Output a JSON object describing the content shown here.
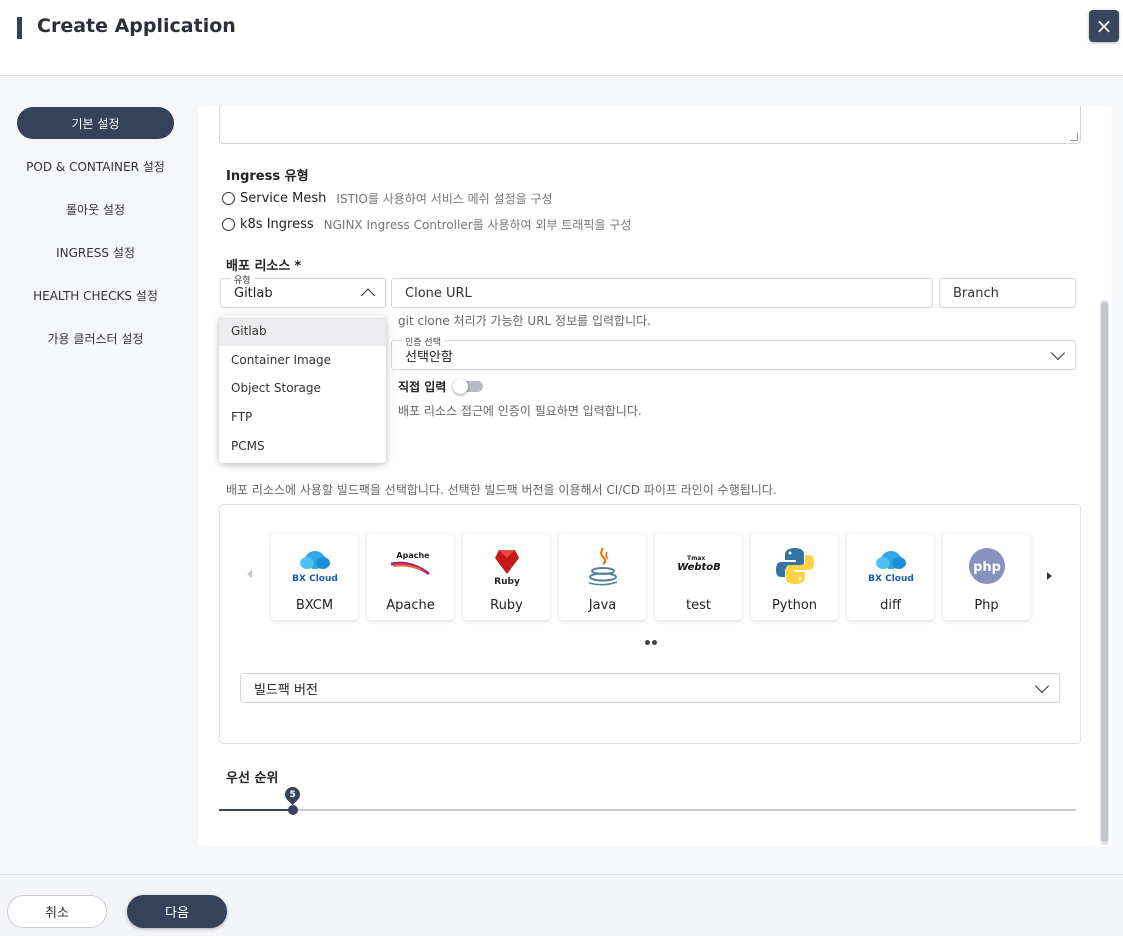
{
  "header": {
    "title": "Create Application",
    "close_icon": "×"
  },
  "sidebar": {
    "items": [
      {
        "label": "기본 설정",
        "active": true
      },
      {
        "label": "POD & CONTAINER 설정"
      },
      {
        "label": "롤아웃 설정"
      },
      {
        "label": "INGRESS 설정"
      },
      {
        "label": "HEALTH CHECKS 설정"
      },
      {
        "label": "가용 클러스터 설정"
      }
    ]
  },
  "ingress": {
    "label": "Ingress 유형",
    "options": [
      {
        "label": "Service Mesh",
        "desc": "ISTIO를 사용하여 서비스 메쉬 설정을 구성"
      },
      {
        "label": "k8s Ingress",
        "desc": "NGINX Ingress Controller를 사용하여 외부 트래픽을 구성"
      }
    ]
  },
  "deploy": {
    "label": "배포 리소스",
    "required": "*",
    "type_label": "유형",
    "type_value": "Gitlab",
    "clone_url_placeholder": "Clone URL",
    "branch_placeholder": "Branch",
    "clone_helper": "git clone 처리가 가능한 URL 정보를 입력합니다.",
    "auth_label": "인증 선택",
    "auth_value": "선택안함",
    "direct_input_label": "직접 입력",
    "auth_helper": "배포 리소스 접근에 인증이 필요하면 입력합니다.",
    "dropdown_options": [
      "Gitlab",
      "Container Image",
      "Object Storage",
      "FTP",
      "PCMS"
    ]
  },
  "buildpack": {
    "helper": "배포 리소스에 사용할 빌드팩을 선택합니다. 선택한 빌드팩 버전을 이용해서 CI/CD 파이프 라인이 수행됩니다.",
    "cards": [
      {
        "label": "BXCM",
        "logo_text": "BX Cloud",
        "icon": "bxcloud-icon"
      },
      {
        "label": "Apache",
        "logo_text": "Apache",
        "icon": "apache-icon"
      },
      {
        "label": "Ruby",
        "logo_text": "Ruby",
        "icon": "ruby-icon"
      },
      {
        "label": "Java",
        "icon": "java-icon"
      },
      {
        "label": "test",
        "logo_text": "WebtoB",
        "logo_small": "Tmax",
        "icon": "webtob-icon"
      },
      {
        "label": "Python",
        "icon": "python-icon"
      },
      {
        "label": "diff",
        "logo_text": "BX Cloud",
        "icon": "bxcloud-icon"
      },
      {
        "label": "Php",
        "logo_text": "php",
        "icon": "php-icon"
      }
    ],
    "version_placeholder": "빌드팩 버전"
  },
  "priority": {
    "label": "우선 순위",
    "value": "5"
  },
  "footer": {
    "cancel_label": "취소",
    "next_label": "다음"
  },
  "colors": {
    "primary": "#36415a",
    "accent_blue": "#2a8de0"
  }
}
